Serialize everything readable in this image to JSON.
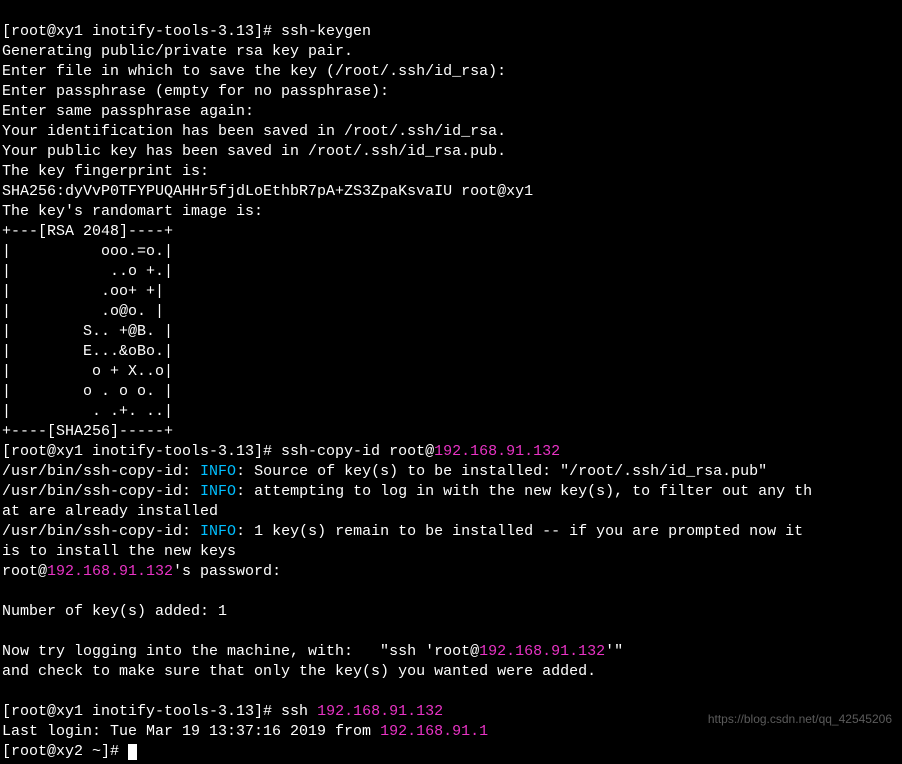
{
  "prompt1_user": "[root@xy1 inotify-tools-3.13]# ",
  "cmd1": "ssh-keygen",
  "lines1": [
    "Generating public/private rsa key pair.",
    "Enter file in which to save the key (/root/.ssh/id_rsa):",
    "Enter passphrase (empty for no passphrase):",
    "Enter same passphrase again:",
    "Your identification has been saved in /root/.ssh/id_rsa.",
    "Your public key has been saved in /root/.ssh/id_rsa.pub.",
    "The key fingerprint is:",
    "SHA256:dyVvP0TFYPUQAHHr5fjdLoEthbR7pA+ZS3ZpaKsvaIU root@xy1",
    "The key's randomart image is:",
    "+---[RSA 2048]----+",
    "|          ooo.=o.|",
    "|           ..o +.|",
    "|          .oo+ +|",
    "|          .o@o. |",
    "|        S.. +@B. |",
    "|        E...&oBo.|",
    "|         o + X..o|",
    "|        o . o o. |",
    "|         . .+. ..|",
    "+----[SHA256]-----+"
  ],
  "prompt2": "[root@xy1 inotify-tools-3.13]# ",
  "cmd2_part1": "ssh-copy-id root@",
  "cmd2_ip": "192.168.91.132",
  "line_copy1a": "/usr/bin/ssh-copy-id: ",
  "info_label": "INFO",
  "line_copy1b": ": Source of key(s) to be installed: \"/root/.ssh/id_rsa.pub\"",
  "line_copy2a": "/usr/bin/ssh-copy-id: ",
  "line_copy2b": ": attempting to log in with the new key(s), to filter out any th",
  "line_copy2c": "at are already installed",
  "line_copy3a": "/usr/bin/ssh-copy-id: ",
  "line_copy3b": ": 1 key(s) remain to be installed -- if you are prompted now it ",
  "line_copy3c": "is to install the new keys",
  "line_rootat": "root@",
  "line_rootip": "192.168.91.132",
  "line_rootpw": "'s password:",
  "line_added": "Number of key(s) added: 1",
  "line_try1a": "Now try logging into the machine, with:   \"ssh 'root@",
  "line_try1_ip": "192.168.91.132",
  "line_try1b": "'\"",
  "line_try2": "and check to make sure that only the key(s) you wanted were added.",
  "prompt3": "[root@xy1 inotify-tools-3.13]# ",
  "cmd3_part1": "ssh ",
  "cmd3_ip": "192.168.91.132",
  "line_last1a": "Last login: Tue Mar 19 13:37:16 2019 from ",
  "line_last1_ip": "192.168.91.1",
  "prompt4": "[root@xy2 ~]# ",
  "watermark": "https://blog.csdn.net/qq_42545206"
}
